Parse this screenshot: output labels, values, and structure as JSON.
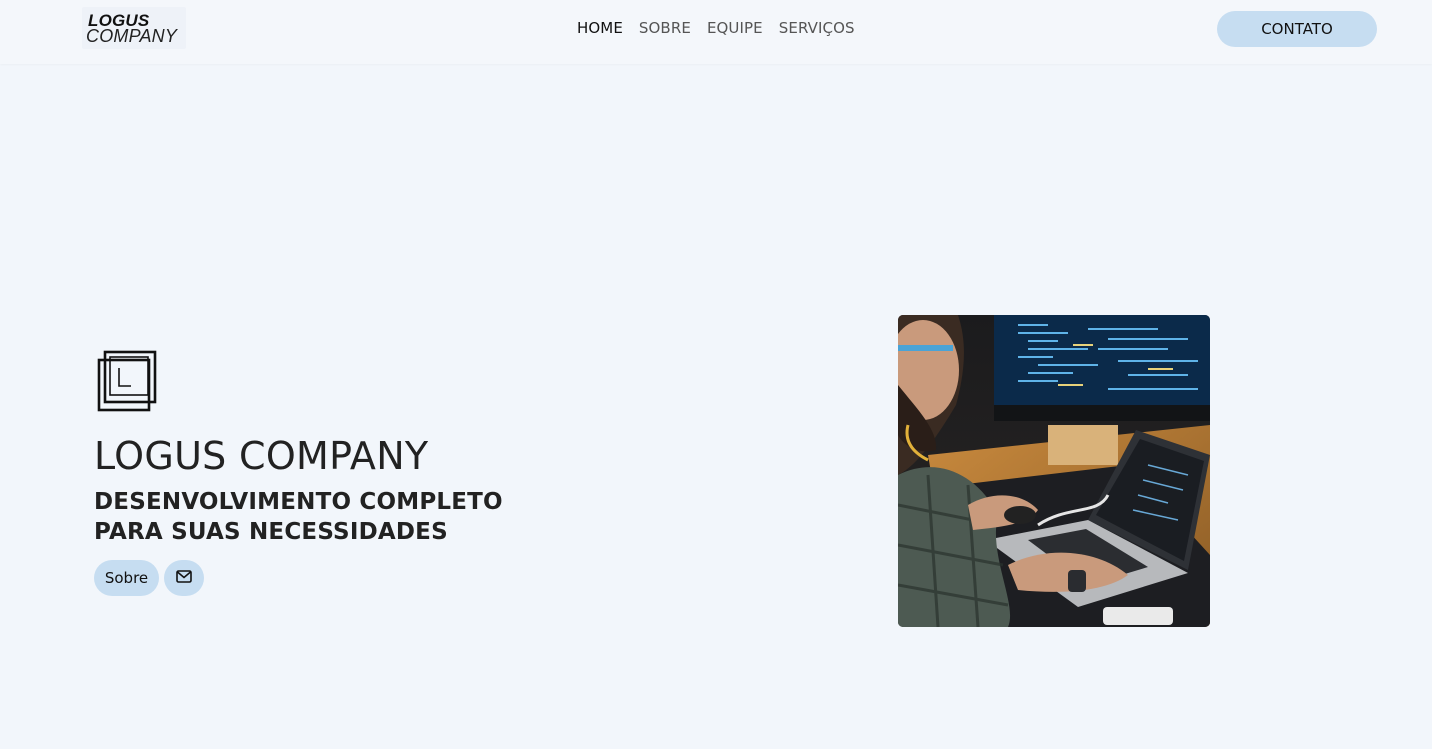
{
  "brand": {
    "line1": "LOGUS",
    "line2": "COMPANY"
  },
  "nav": {
    "items": [
      {
        "label": "HOME",
        "active": true
      },
      {
        "label": "SOBRE",
        "active": false
      },
      {
        "label": "EQUIPE",
        "active": false
      },
      {
        "label": "SERVIÇOS",
        "active": false
      }
    ],
    "contact_label": "CONTATO"
  },
  "hero": {
    "icon": "overlapping-squares-logo-icon",
    "title": "LOGUS COMPANY",
    "subtitle": "DESENVOLVIMENTO COMPLETO PARA SUAS NECESSIDADES",
    "buttons": {
      "sobre_label": "Sobre",
      "mail_icon": "envelope-icon"
    },
    "image_alt": "Programmer coding on laptop and monitor"
  },
  "colors": {
    "page_bg": "#f2f6fb",
    "button_bg": "#c6ddf1",
    "text": "#212529"
  }
}
